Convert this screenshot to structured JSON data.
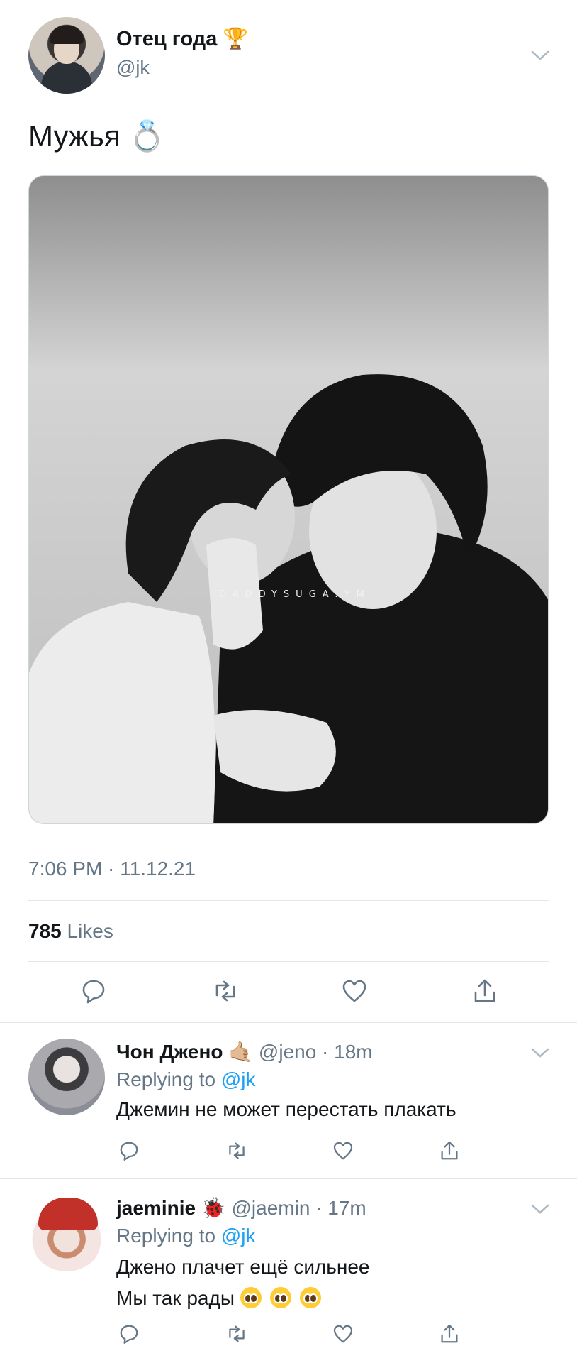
{
  "tweet": {
    "display_name": "Отец года 🏆",
    "handle": "@jk",
    "text": "Мужья 💍",
    "image_watermark": "DADDYSUGA.YM",
    "timestamp": "7:06 PM · 11.12.21",
    "likes_count": "785",
    "likes_label": " Likes",
    "actions": [
      "reply-icon",
      "retweet-icon",
      "like-icon",
      "share-icon"
    ]
  },
  "replies": [
    {
      "name": "Чон Джено 🤙🏼",
      "handle_time": " @jeno · 18m",
      "replying_prefix": "Replying to ",
      "replying_to": "@jk",
      "lines": [
        "Джемин не может перестать плакать"
      ]
    },
    {
      "name": "jaeminie 🐞",
      "handle_time": " @jaemin · 17m",
      "replying_prefix": "Replying to ",
      "replying_to": "@jk",
      "lines": [
        "Джено плачет ещё сильнее",
        "Мы так рады"
      ],
      "emoji": "pleading-face x3"
    }
  ],
  "colors": {
    "link": "#1da1f2",
    "secondary": "#657786",
    "divider": "#e1e8ed"
  }
}
